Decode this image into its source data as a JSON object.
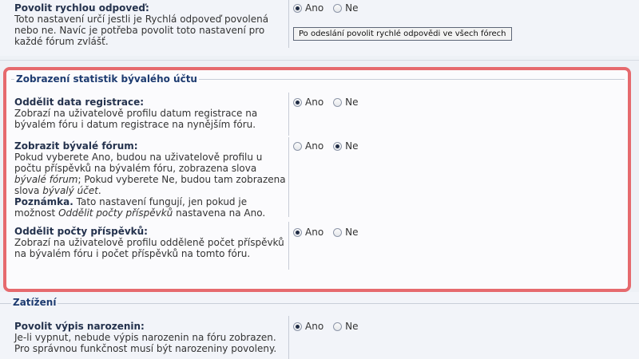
{
  "top": {
    "title": "Povolit rychlou odpoveď:",
    "desc": "Toto nastavení určí jestli je Rychlá odpoveď povolená nebo ne. Navíc je potřeba povolit toto nastavení pro každé fórum zvlášť.",
    "opt_yes": "Ano",
    "opt_no": "Ne",
    "selected": "Ano",
    "button": "Po odeslání povolit rychlé odpovědi ve všech fórech"
  },
  "section": {
    "legend": "Zobrazení statistik bývalého účtu",
    "items": [
      {
        "title": "Oddělit data registrace:",
        "desc": "Zobrazí na uživatelově profilu datum registrace na bývalém fóru i datum registrace na nynějším fóru.",
        "opt_yes": "Ano",
        "opt_no": "Ne",
        "selected": "Ano"
      },
      {
        "title": "Zobrazit bývalé fórum:",
        "desc_1": "Pokud vyberete Ano, budou na uživatelově profilu u počtu příspěvků na bývalém fóru, zobrazena slova ",
        "desc_em_1": "bývalé fórum",
        "desc_2": "; Pokud vyberete Ne, budou tam zobrazena slova ",
        "desc_em_2": "bývalý účet",
        "desc_3": ".",
        "note_label": "Poznámka.",
        "note_1": " Tato nastavení fungují, jen pokud je možnost ",
        "note_em": "Oddělit počty příspěvků",
        "note_2": " nastavena na Ano.",
        "opt_yes": "Ano",
        "opt_no": "Ne",
        "selected": "Ne"
      },
      {
        "title": "Oddělit počty příspěvků:",
        "desc": "Zobrazí na uživatelově profilu odděleně počet příspěvků na bývalém fóru i počet příspěvků na tomto fóru.",
        "opt_yes": "Ano",
        "opt_no": "Ne",
        "selected": "Ano"
      }
    ]
  },
  "load_section": {
    "legend": "Zatížení",
    "items": [
      {
        "title": "Povolit výpis narozenin:",
        "desc": "Je-li vypnut, nebude výpis narozenin na fóru zobrazen. Pro správnou funkčnost musí být narozeniny povoleny.",
        "opt_yes": "Ano",
        "opt_no": "Ne",
        "selected": "Ano"
      }
    ]
  }
}
